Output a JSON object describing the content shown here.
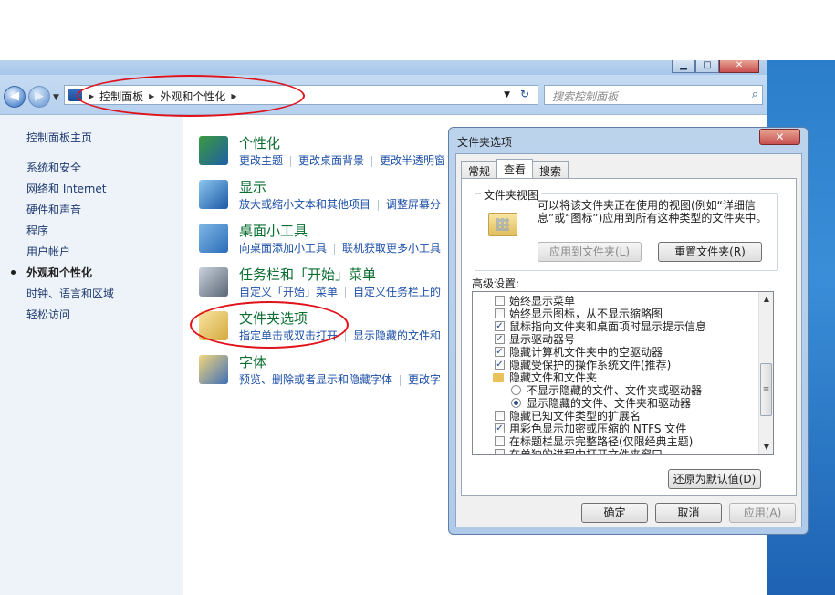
{
  "navbar": {
    "breadcrumb": [
      "控制面板",
      "外观和个性化"
    ],
    "search_placeholder": "搜索控制面板"
  },
  "sidebar": {
    "items": [
      {
        "label": "控制面板主页",
        "active": false
      },
      {
        "label": "系统和安全",
        "active": false
      },
      {
        "label": "网络和 Internet",
        "active": false
      },
      {
        "label": "硬件和声音",
        "active": false
      },
      {
        "label": "程序",
        "active": false
      },
      {
        "label": "用户帐户",
        "active": false
      },
      {
        "label": "外观和个性化",
        "active": true
      },
      {
        "label": "时钟、语言和区域",
        "active": false
      },
      {
        "label": "轻松访问",
        "active": false
      }
    ]
  },
  "categories": [
    {
      "title": "个性化",
      "links": [
        "更改主题",
        "更改桌面背景",
        "更改半透明窗"
      ],
      "icon": "personalization-icon"
    },
    {
      "title": "显示",
      "links": [
        "放大或缩小文本和其他项目",
        "调整屏幕分"
      ],
      "icon": "display-icon"
    },
    {
      "title": "桌面小工具",
      "links": [
        "向桌面添加小工具",
        "联机获取更多小工具"
      ],
      "icon": "gadgets-icon"
    },
    {
      "title": "任务栏和「开始」菜单",
      "links": [
        "自定义「开始」菜单",
        "自定义任务栏上的"
      ],
      "icon": "taskbar-icon"
    },
    {
      "title": "文件夹选项",
      "links": [
        "指定单击或双击打开",
        "显示隐藏的文件和"
      ],
      "icon": "folder-options-icon"
    },
    {
      "title": "字体",
      "links": [
        "预览、删除或者显示和隐藏字体",
        "更改字"
      ],
      "icon": "fonts-icon"
    }
  ],
  "dialog": {
    "title": "文件夹选项",
    "close_label": "✕",
    "tabs": [
      {
        "label": "常规",
        "active": false
      },
      {
        "label": "查看",
        "active": true
      },
      {
        "label": "搜索",
        "active": false
      }
    ],
    "folder_view": {
      "label": "文件夹视图",
      "description": "可以将该文件夹正在使用的视图(例如“详细信息”或“图标”)应用到所有这种类型的文件夹中。",
      "apply_button": "应用到文件夹(L)",
      "reset_button": "重置文件夹(R)"
    },
    "advanced_label": "高级设置:",
    "advanced_items": [
      {
        "type": "checkbox",
        "checked": false,
        "label": "始终显示菜单",
        "indent": 0
      },
      {
        "type": "checkbox",
        "checked": false,
        "label": "始终显示图标，从不显示缩略图",
        "indent": 0
      },
      {
        "type": "checkbox",
        "checked": true,
        "label": "鼠标指向文件夹和桌面项时显示提示信息",
        "indent": 0
      },
      {
        "type": "checkbox",
        "checked": true,
        "label": "显示驱动器号",
        "indent": 0
      },
      {
        "type": "checkbox",
        "checked": true,
        "label": "隐藏计算机文件夹中的空驱动器",
        "indent": 0
      },
      {
        "type": "checkbox",
        "checked": true,
        "label": "隐藏受保护的操作系统文件(推荐)",
        "indent": 0
      },
      {
        "type": "folder",
        "label": "隐藏文件和文件夹",
        "indent": 0
      },
      {
        "type": "radio",
        "checked": false,
        "label": "不显示隐藏的文件、文件夹或驱动器",
        "indent": 1
      },
      {
        "type": "radio",
        "checked": true,
        "label": "显示隐藏的文件、文件夹和驱动器",
        "indent": 1
      },
      {
        "type": "checkbox",
        "checked": false,
        "label": "隐藏已知文件类型的扩展名",
        "indent": 0
      },
      {
        "type": "checkbox",
        "checked": true,
        "label": "用彩色显示加密或压缩的 NTFS 文件",
        "indent": 0
      },
      {
        "type": "checkbox",
        "checked": false,
        "label": "在标题栏显示完整路径(仅限经典主题)",
        "indent": 0
      },
      {
        "type": "checkbox",
        "checked": false,
        "label": "在单独的进程中打开文件夹窗口",
        "indent": 0
      }
    ],
    "restore_defaults": "还原为默认值(D)",
    "ok": "确定",
    "cancel": "取消",
    "apply": "应用(A)"
  },
  "colors": {
    "annotation_red": "#e0131b",
    "category_title": "#0a6e31",
    "link_blue": "#1c4fa8"
  }
}
